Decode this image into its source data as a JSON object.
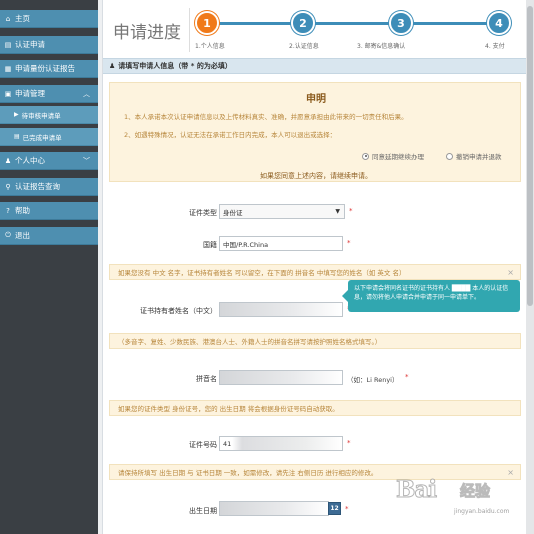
{
  "sidebar": {
    "items": [
      {
        "icon": "home-icon",
        "label": "主页"
      },
      {
        "icon": "certificate-icon",
        "label": "认证申请"
      },
      {
        "icon": "document-icon",
        "label": "申请量份认证报告"
      },
      {
        "icon": "apply-manage-icon",
        "label": "申请管理",
        "expanded": true
      },
      {
        "icon": "user-icon",
        "label": "个人中心"
      },
      {
        "icon": "search-icon",
        "label": "认证报告查询"
      },
      {
        "icon": "help-icon",
        "label": "帮助"
      },
      {
        "icon": "power-icon",
        "label": "退出"
      }
    ],
    "subitems": [
      {
        "icon": "cart-icon",
        "label": "待审核申请单"
      },
      {
        "icon": "list-icon",
        "label": "已完成申请单"
      }
    ]
  },
  "steps": {
    "title": "申请进度",
    "items": [
      {
        "number": "1",
        "label": "1.个人信息"
      },
      {
        "number": "2",
        "label": "2.认证信息"
      },
      {
        "number": "3",
        "label": "3. 邮寄&信息确认"
      },
      {
        "number": "4",
        "label": "4. 支付"
      }
    ],
    "active": 1
  },
  "section": {
    "title": "请填写申请人信息（带 * 的为必填）"
  },
  "declaration": {
    "title": "申明",
    "lines": [
      "1、本人承诺本次认证申请信息以及上传材料真实、准确，并愿意承担由此带来的一切责任和后果。",
      "2、如遇特殊情况，认证无法在承诺工作日内完成，本人可以退出或选择："
    ],
    "options": [
      "同意延期继续办理",
      "撤销申请并退款"
    ],
    "selected": 0,
    "footer": "如果您同意上述内容，请继续申请。"
  },
  "form": {
    "cert_type": {
      "label": "证件类型",
      "value": "身份证",
      "required": "*"
    },
    "nationality": {
      "label": "国籍",
      "value": "中国/P.R.China",
      "required": "*"
    },
    "note_name": "如果您没有 中文 名字，证书持有者姓名 可以留空，在下面的 拼音名 中填写您的姓名（如 英文 名）",
    "tooltip": "以下申请会将同名证书的证书持有人 ████ 本人的认证信息，请勿将他人申请合并申请于同一申请单下。",
    "holder_name": {
      "label": "证书持有者姓名（中文）",
      "value": "",
      "required": "*"
    },
    "note_pinyin": "（多音字、复姓、少数民族、港澳台人士、外籍人士的拼音名拼写请按护照姓名格式填写。）",
    "pinyin": {
      "label": "拼音名",
      "value": "",
      "hint": "（如：Li Renyi）",
      "required": "*"
    },
    "note_id": "如果您的证件类型 身份证号，您的 出生日期 将会根据身份证号码自动获取。",
    "id_number": {
      "label": "证件号码",
      "value": "41",
      "required": "*"
    },
    "note_birth": "请保持所填写 出生日期 与 证书日期 一致，如需修改，请先注 右侧日历 进行相应的修改。",
    "birth": {
      "label": "出生日期",
      "value": "",
      "required": "*",
      "calendar": "12"
    }
  },
  "watermark": {
    "brand": "Bai",
    "sub": "经验",
    "url": "jingyan.baidu.com"
  }
}
